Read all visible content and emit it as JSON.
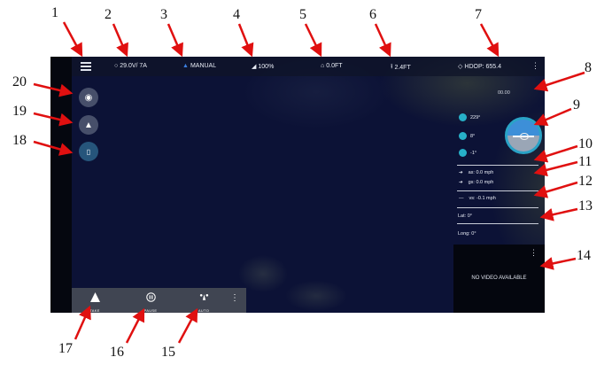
{
  "topbar": {
    "voltage": "29.0V/ 7A",
    "mode": "MANUAL",
    "signal": "100%",
    "home_alt": "0.0FT",
    "alt": "2.4FT",
    "hdop": "HDOP: 655.4"
  },
  "panel": {
    "distance": "00.00",
    "yaw": "229°",
    "pitch": "8°",
    "roll": "-1°",
    "airspeed": "as: 0.0 mph",
    "groundspeed": "gs: 0.0 mph",
    "vspeed": "vs: -0.1 mph",
    "lat": "Lat: 0°",
    "long": "Long: 0°"
  },
  "video": {
    "label": "NO VIDEO AVAILABLE"
  },
  "bottombar": {
    "takeoff": "TAKE",
    "pause": "PAUSE",
    "auto": "AUTO"
  },
  "callouts": [
    "1",
    "2",
    "3",
    "4",
    "5",
    "6",
    "7",
    "8",
    "9",
    "10",
    "11",
    "12",
    "13",
    "14",
    "15",
    "16",
    "17",
    "18",
    "19",
    "20"
  ],
  "colors": {
    "accent": "#2aa3c6",
    "map": "#0c1236",
    "arrow": "#e01010"
  }
}
